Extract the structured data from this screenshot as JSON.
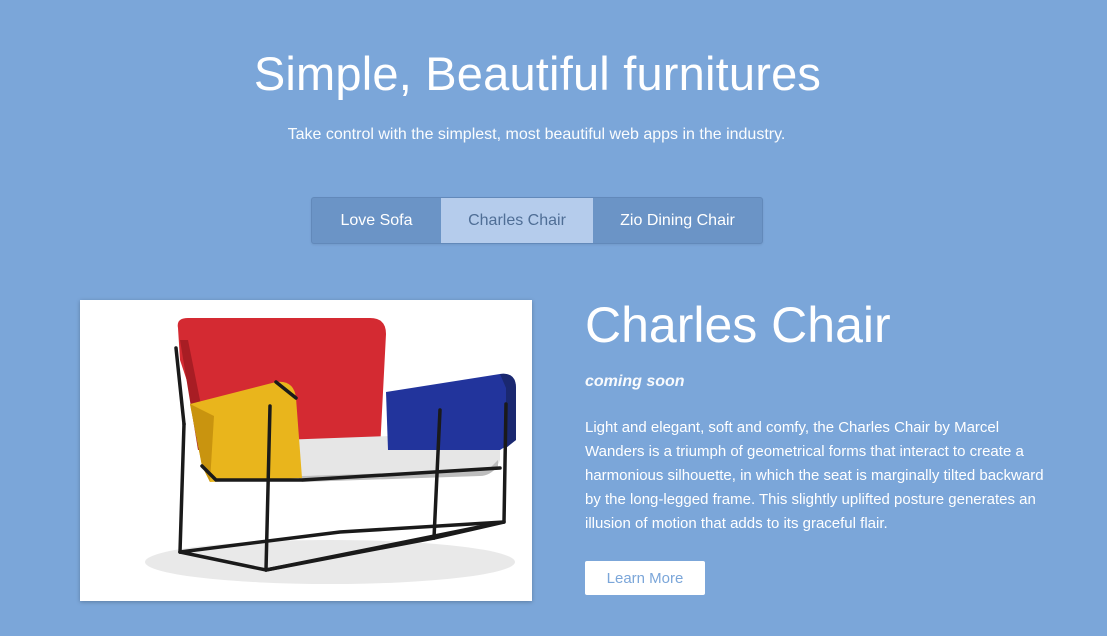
{
  "hero": {
    "title": "Simple, Beautiful furnitures",
    "subtitle": "Take control with the simplest, most beautiful web apps in the industry."
  },
  "tabs": [
    {
      "label": "Love Sofa",
      "active": false
    },
    {
      "label": "Charles Chair",
      "active": true
    },
    {
      "label": "Zio Dining Chair",
      "active": false
    }
  ],
  "product": {
    "title": "Charles Chair",
    "status": "coming soon",
    "description": "Light and elegant, soft and comfy, the Charles Chair by Marcel Wanders is a triumph of geometrical forms that interact to create a harmonious silhouette, in which the seat is marginally tilted backward by the long-legged frame. This slightly uplifted posture generates an illusion of motion that adds to its graceful flair.",
    "cta_label": "Learn More"
  },
  "colors": {
    "background": "#7ba6d9",
    "tab_bar": "#6b94c6",
    "tab_active": "#b5ccec",
    "chair_red": "#d42a32",
    "chair_yellow": "#e9b51c",
    "chair_blue": "#22349c",
    "chair_seat": "#e6e6e6"
  }
}
